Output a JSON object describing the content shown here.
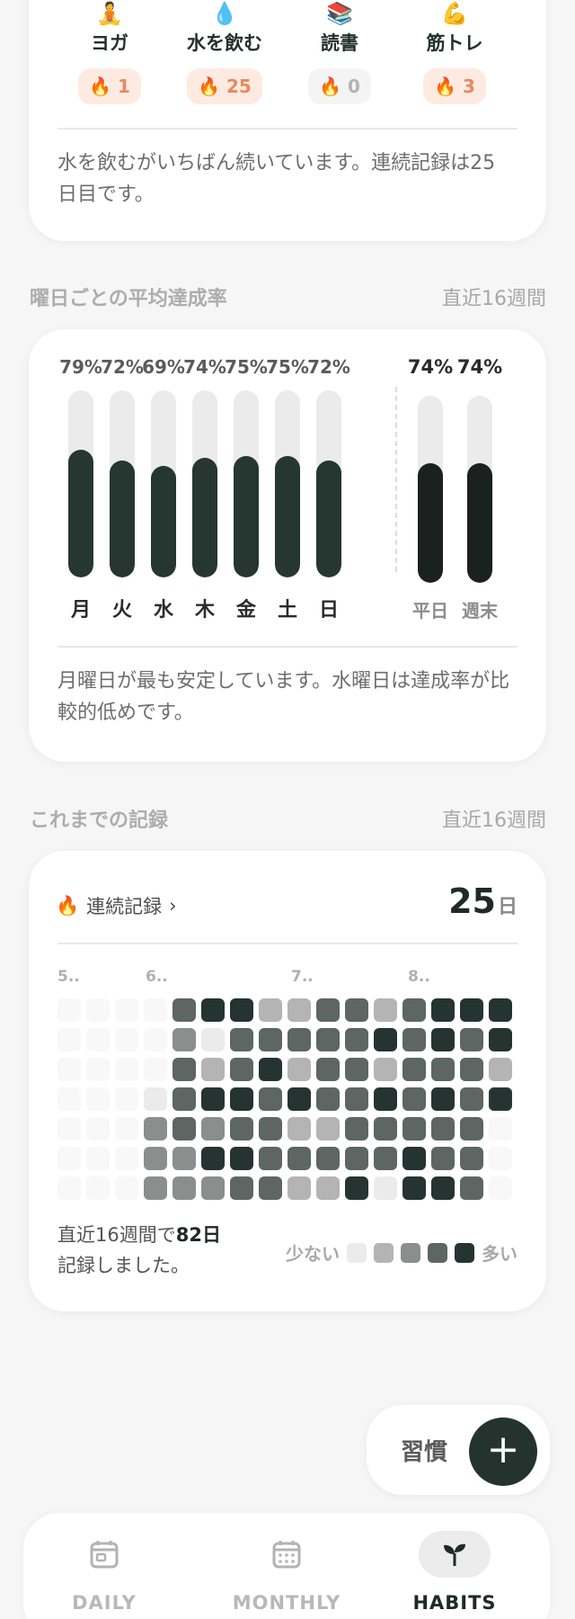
{
  "habits": [
    {
      "icon": "🧘",
      "icon_name": "yoga-icon",
      "name": "ヨガ",
      "streak": "1",
      "active": true
    },
    {
      "icon": "💧",
      "icon_name": "water-drop-icon",
      "name": "水を飲む",
      "streak": "25",
      "active": true
    },
    {
      "icon": "📚",
      "icon_name": "books-icon",
      "name": "読書",
      "streak": "0",
      "active": false
    },
    {
      "icon": "💪",
      "icon_name": "muscle-icon",
      "name": "筋トレ",
      "streak": "3",
      "active": true
    }
  ],
  "habits_insight": "水を飲むがいちばん続いています。連続記録は25日目です。",
  "weekday": {
    "title": "曜日ごとの平均達成率",
    "meta": "直近16週間",
    "days": [
      {
        "label": "月",
        "pct_text": "79%",
        "value": 79
      },
      {
        "label": "火",
        "pct_text": "72%",
        "value": 72
      },
      {
        "label": "水",
        "pct_text": "69%",
        "value": 69
      },
      {
        "label": "木",
        "pct_text": "74%",
        "value": 74
      },
      {
        "label": "金",
        "pct_text": "75%",
        "value": 75
      },
      {
        "label": "土",
        "pct_text": "75%",
        "value": 75
      },
      {
        "label": "日",
        "pct_text": "72%",
        "value": 72
      }
    ],
    "groups": [
      {
        "label": "平日",
        "pct_text": "74%",
        "value": 74
      },
      {
        "label": "週末",
        "pct_text": "74%",
        "value": 74
      }
    ],
    "insight": "月曜日が最も安定しています。水曜日は達成率が比較的低めです。"
  },
  "record": {
    "title": "これまでの記録",
    "meta": "直近16週間",
    "streak_label": "連続記録",
    "streak_value": "25",
    "streak_unit": "日",
    "months": [
      "5..",
      "6..",
      "7..",
      "8.."
    ],
    "heatmap_levels": [
      [
        0,
        0,
        0,
        0,
        0,
        0,
        0
      ],
      [
        0,
        0,
        0,
        0,
        0,
        0,
        0
      ],
      [
        0,
        0,
        0,
        0,
        0,
        0,
        0
      ],
      [
        0,
        0,
        0,
        1,
        4,
        4,
        4
      ],
      [
        3,
        4,
        3,
        3,
        3,
        4,
        4
      ],
      [
        5,
        1,
        2,
        5,
        4,
        5,
        4
      ],
      [
        5,
        3,
        3,
        5,
        3,
        5,
        3
      ],
      [
        2,
        3,
        5,
        3,
        3,
        3,
        3
      ],
      [
        2,
        3,
        2,
        5,
        2,
        3,
        2
      ],
      [
        3,
        3,
        3,
        3,
        2,
        3,
        2
      ],
      [
        3,
        3,
        3,
        3,
        3,
        3,
        5
      ],
      [
        2,
        5,
        2,
        5,
        3,
        3,
        1
      ],
      [
        3,
        3,
        3,
        3,
        3,
        5,
        5
      ],
      [
        5,
        5,
        3,
        5,
        3,
        3,
        5
      ],
      [
        5,
        3,
        3,
        3,
        3,
        3,
        3
      ],
      [
        5,
        5,
        2,
        5,
        0,
        0,
        0
      ]
    ],
    "summary_prefix": "直近16週間で",
    "summary_count": "82日",
    "summary_suffix": "記録しました。",
    "legend_less": "少ない",
    "legend_more": "多い"
  },
  "fab": {
    "label": "習慣",
    "icon": "+"
  },
  "nav": [
    {
      "label": "DAILY",
      "icon_name": "daily-calendar-icon",
      "active": false
    },
    {
      "label": "MONTHLY",
      "icon_name": "monthly-calendar-icon",
      "active": false
    },
    {
      "label": "HABITS",
      "icon_name": "sprout-icon",
      "active": true
    }
  ],
  "colors": {
    "accent": "#24332e",
    "streak_badge_bg": "#fdebe2",
    "streak_badge_text": "#e9895e",
    "heat_0": "#f8f8f8",
    "heat_1": "#ebebeb",
    "heat_2": "#b4b4b4",
    "heat_3": "#5d6662",
    "heat_4": "#8a8f8d",
    "heat_5": "#253430"
  }
}
